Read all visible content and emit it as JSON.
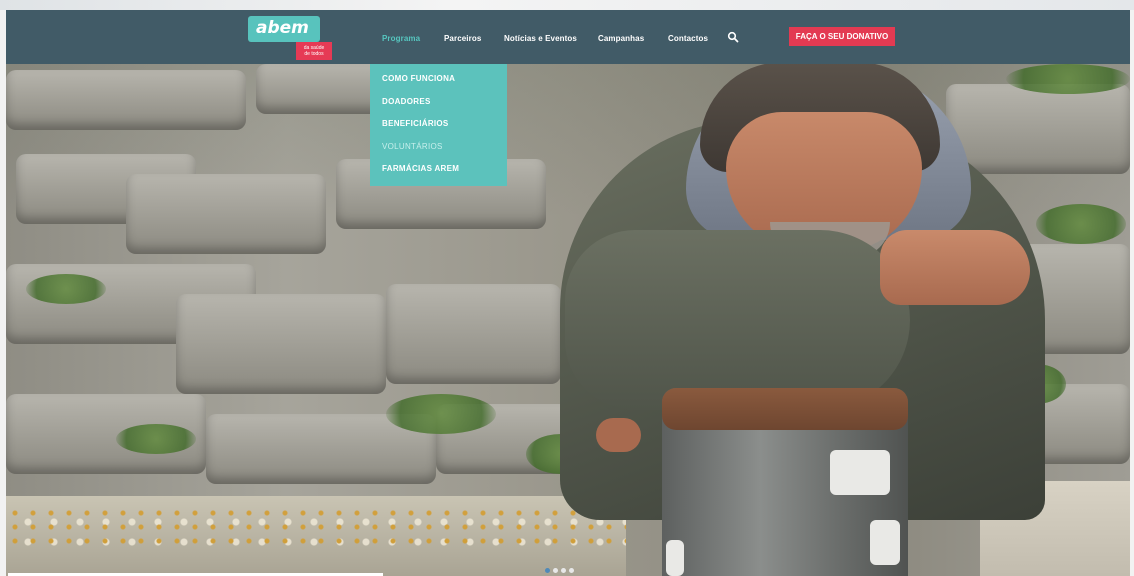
{
  "brand": {
    "logo_text": "abem",
    "logo_tag_line1": "da saúde",
    "logo_tag_line2": "de todos",
    "colors": {
      "nav": "#415b67",
      "accent": "#56c6bf",
      "donate": "#e33a52"
    }
  },
  "nav": {
    "items": [
      {
        "label": "Programa",
        "active": true
      },
      {
        "label": "Parceiros"
      },
      {
        "label": "Notícias e Eventos"
      },
      {
        "label": "Campanhas"
      },
      {
        "label": "Contactos"
      }
    ],
    "search_icon": "search-icon",
    "donate_label": "FAÇA O SEU DONATIVO"
  },
  "dropdown": {
    "items": [
      {
        "label": "COMO FUNCIONA"
      },
      {
        "label": "DOADORES"
      },
      {
        "label": "BENEFICIÁRIOS"
      },
      {
        "label": "VOLUNTÁRIOS"
      },
      {
        "label": "FARMÁCIAS AREM"
      }
    ]
  },
  "slider": {
    "count": 4,
    "active_index": 0
  }
}
